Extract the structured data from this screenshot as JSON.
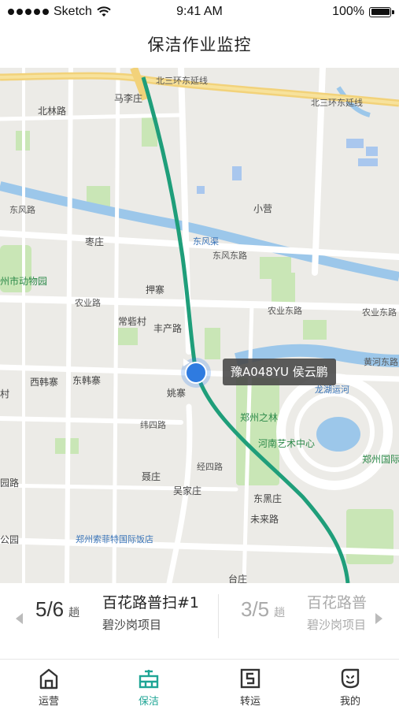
{
  "status_bar": {
    "carrier": "Sketch",
    "time": "9:41 AM",
    "battery": "100%"
  },
  "nav": {
    "title": "保洁作业监控"
  },
  "map": {
    "labels": {
      "north3_ext_a": "北三环东延线",
      "north3_ext_b": "北三环东延线",
      "beilin_rd": "北林路",
      "mali_zhuang": "马李庄",
      "xiaoying": "小营",
      "dongfeng_rd": "东风路",
      "dongfeng_canal": "东风渠",
      "dongfeng_rd2": "东风东路",
      "zaozhuang": "枣庄",
      "zoo": "州市动物园",
      "yazhai": "押寨",
      "nongye_rd": "农业路",
      "nongye_east": "农业东路",
      "changqiao": "常砦村",
      "fengchan_rd": "丰产路",
      "xihanzhai": "西韩寨",
      "donghanzhai": "东韩寨",
      "yaozhuang": "姚寨",
      "huanghe_east": "黄河东路",
      "longhu": "龙湖",
      "longyun_he": "龙湖运河",
      "zhengzhou_forest": "郑州之林",
      "art_center": "河南艺术中心",
      "zhengzhou_intl": "郑州国际",
      "nie_zhuang": "聂庄",
      "wujia_zhuang": "吴家庄",
      "dongzhuang": "东黑庄",
      "weilai_rd": "未来路",
      "jingsi_rd": "经四路",
      "guoshan_gongyuan": "公园",
      "sofitel": "郑州索菲特国际饭店",
      "taizhuang": "台庄",
      "huangzhuang": "黄河路",
      "weisi_rd": "纬四路",
      "village_left": "村",
      "park_left": "园路",
      "nongye_rd2": "农业东路"
    }
  },
  "vehicle": {
    "plate_driver": "豫A048YU 侯云鹏"
  },
  "tasks": [
    {
      "count": "5/6",
      "unit": "趟",
      "name": "百花路普扫#1",
      "project": "碧沙岗项目"
    },
    {
      "count": "3/5",
      "unit": "趟",
      "name": "百花路普",
      "project": "碧沙岗项目"
    }
  ],
  "tabs": [
    {
      "label": "运营",
      "icon": "home-icon"
    },
    {
      "label": "保洁",
      "icon": "cleaning-icon"
    },
    {
      "label": "转运",
      "icon": "transfer-icon"
    },
    {
      "label": "我的",
      "icon": "profile-icon"
    }
  ],
  "colors": {
    "accent": "#1fa595",
    "route": "#1f9e7a",
    "marker": "#2f7be0"
  }
}
